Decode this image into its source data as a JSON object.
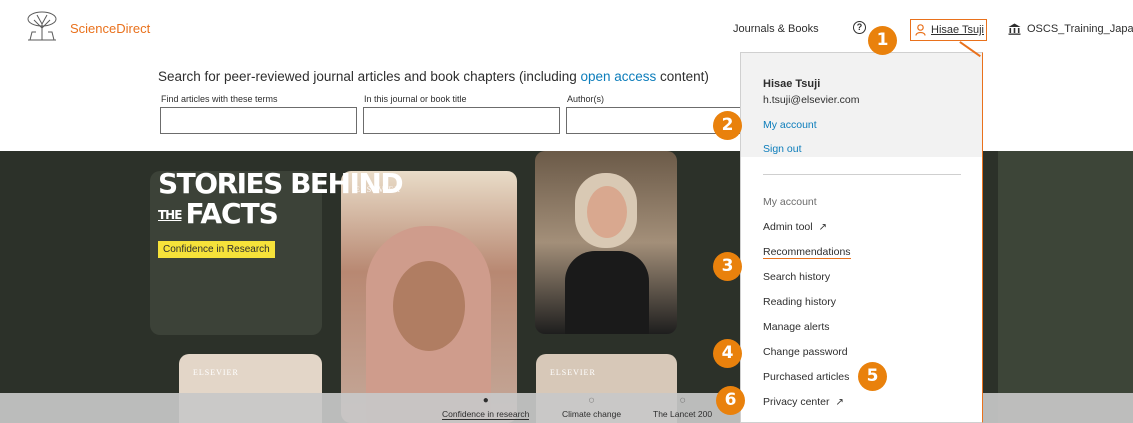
{
  "header": {
    "brand": "ScienceDirect",
    "journals_books": "Journals & Books",
    "help_glyph": "?",
    "user_name": "Hisae Tsuji",
    "institution": "OSCS_Training_Japan"
  },
  "search": {
    "title_prefix": "Search for peer-reviewed journal articles and book chapters (including ",
    "title_link": "open access",
    "title_suffix": " content)",
    "field1_label": "Find articles with these terms",
    "field2_label": "In this journal or book title",
    "field3_label": "Author(s)",
    "field1_value": "",
    "field2_value": "",
    "field3_value": ""
  },
  "hero": {
    "headline_line1": "STORIES BEHIND",
    "headline_the": "THE",
    "headline_line2": "FACTS",
    "tag": "Confidence in Research",
    "elsevier_mark": "ELSEVIER"
  },
  "carousel": {
    "items": [
      {
        "label": "Confidence in research",
        "glyph": "●",
        "active": true
      },
      {
        "label": "Climate change",
        "glyph": "◌",
        "active": false
      },
      {
        "label": "The Lancet 200",
        "glyph": "◌",
        "active": false
      }
    ]
  },
  "dropdown": {
    "name": "Hisae Tsuji",
    "email": "h.tsuji@elsevier.com",
    "my_account_link": "My account",
    "sign_out": "Sign out",
    "section_label": "My account",
    "items": [
      {
        "label": "Admin tool",
        "external": true
      },
      {
        "label": "Recommendations",
        "external": false
      },
      {
        "label": "Search history",
        "external": false
      },
      {
        "label": "Reading history",
        "external": false
      },
      {
        "label": "Manage alerts",
        "external": false
      },
      {
        "label": "Change password",
        "external": false
      },
      {
        "label": "Purchased articles",
        "external": false
      },
      {
        "label": "Privacy center",
        "external": true
      }
    ],
    "external_glyph": "↗"
  },
  "callouts": [
    "1",
    "2",
    "3",
    "4",
    "5",
    "6"
  ],
  "colors": {
    "accent": "#e9711c",
    "badge": "#e9810c",
    "link": "#0c7dbb",
    "tag": "#f6e23a",
    "hero_bg": "#2c3129"
  },
  "icons": {
    "user": "person-icon",
    "institution": "institution-icon",
    "help": "help-circle-icon",
    "logo": "elsevier-tree-logo"
  }
}
